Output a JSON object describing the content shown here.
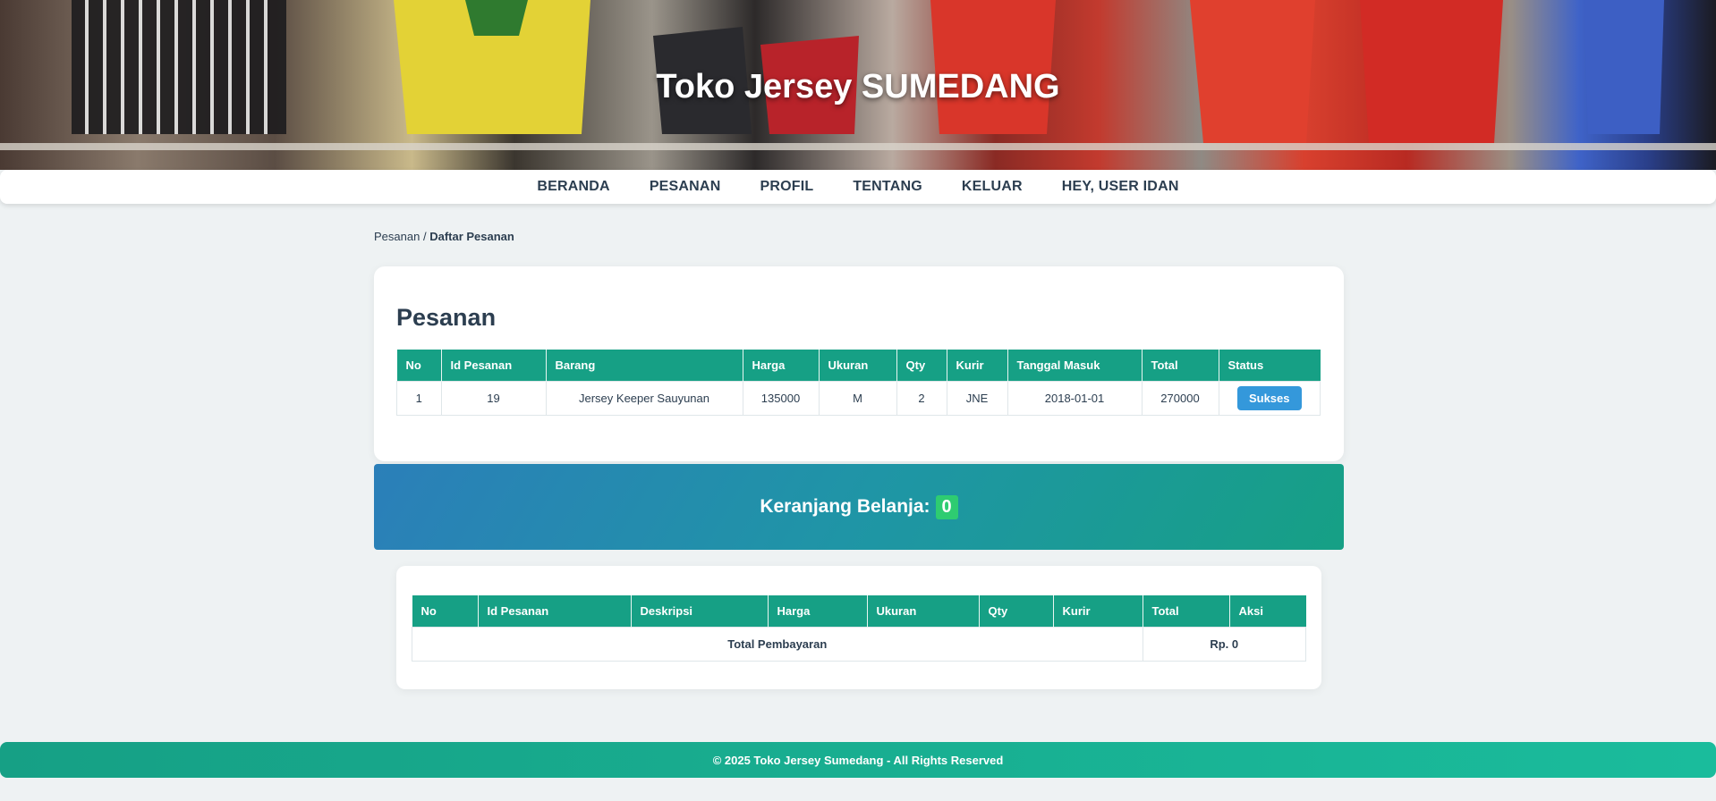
{
  "hero": {
    "title": "Toko Jersey SUMEDANG"
  },
  "nav": {
    "items": [
      {
        "label": "BERANDA"
      },
      {
        "label": "PESANAN"
      },
      {
        "label": "PROFIL"
      },
      {
        "label": "TENTANG"
      },
      {
        "label": "KELUAR"
      },
      {
        "label": "HEY, USER IDAN"
      }
    ]
  },
  "breadcrumb": {
    "parent": "Pesanan",
    "separator": "/",
    "current": "Daftar Pesanan"
  },
  "orders": {
    "title": "Pesanan",
    "headers": [
      "No",
      "Id Pesanan",
      "Barang",
      "Harga",
      "Ukuran",
      "Qty",
      "Kurir",
      "Tanggal Masuk",
      "Total",
      "Status"
    ],
    "rows": [
      {
        "no": "1",
        "id": "19",
        "barang": "Jersey Keeper Sauyunan",
        "harga": "135000",
        "ukuran": "M",
        "qty": "2",
        "kurir": "JNE",
        "tanggal": "2018-01-01",
        "total": "270000",
        "status": "Sukses"
      }
    ]
  },
  "cart": {
    "label": "Keranjang Belanja:",
    "count": "0",
    "headers": [
      "No",
      "Id Pesanan",
      "Deskripsi",
      "Harga",
      "Ukuran",
      "Qty",
      "Kurir",
      "Total",
      "Aksi"
    ],
    "total_label": "Total Pembayaran",
    "total_value": "Rp. 0"
  },
  "footer": {
    "text": "© 2025 Toko Jersey Sumedang - All Rights Reserved"
  },
  "colors": {
    "primary": "#16a085",
    "button": "#3498db",
    "badge": "#2ecc71",
    "text": "#2c3e50"
  }
}
